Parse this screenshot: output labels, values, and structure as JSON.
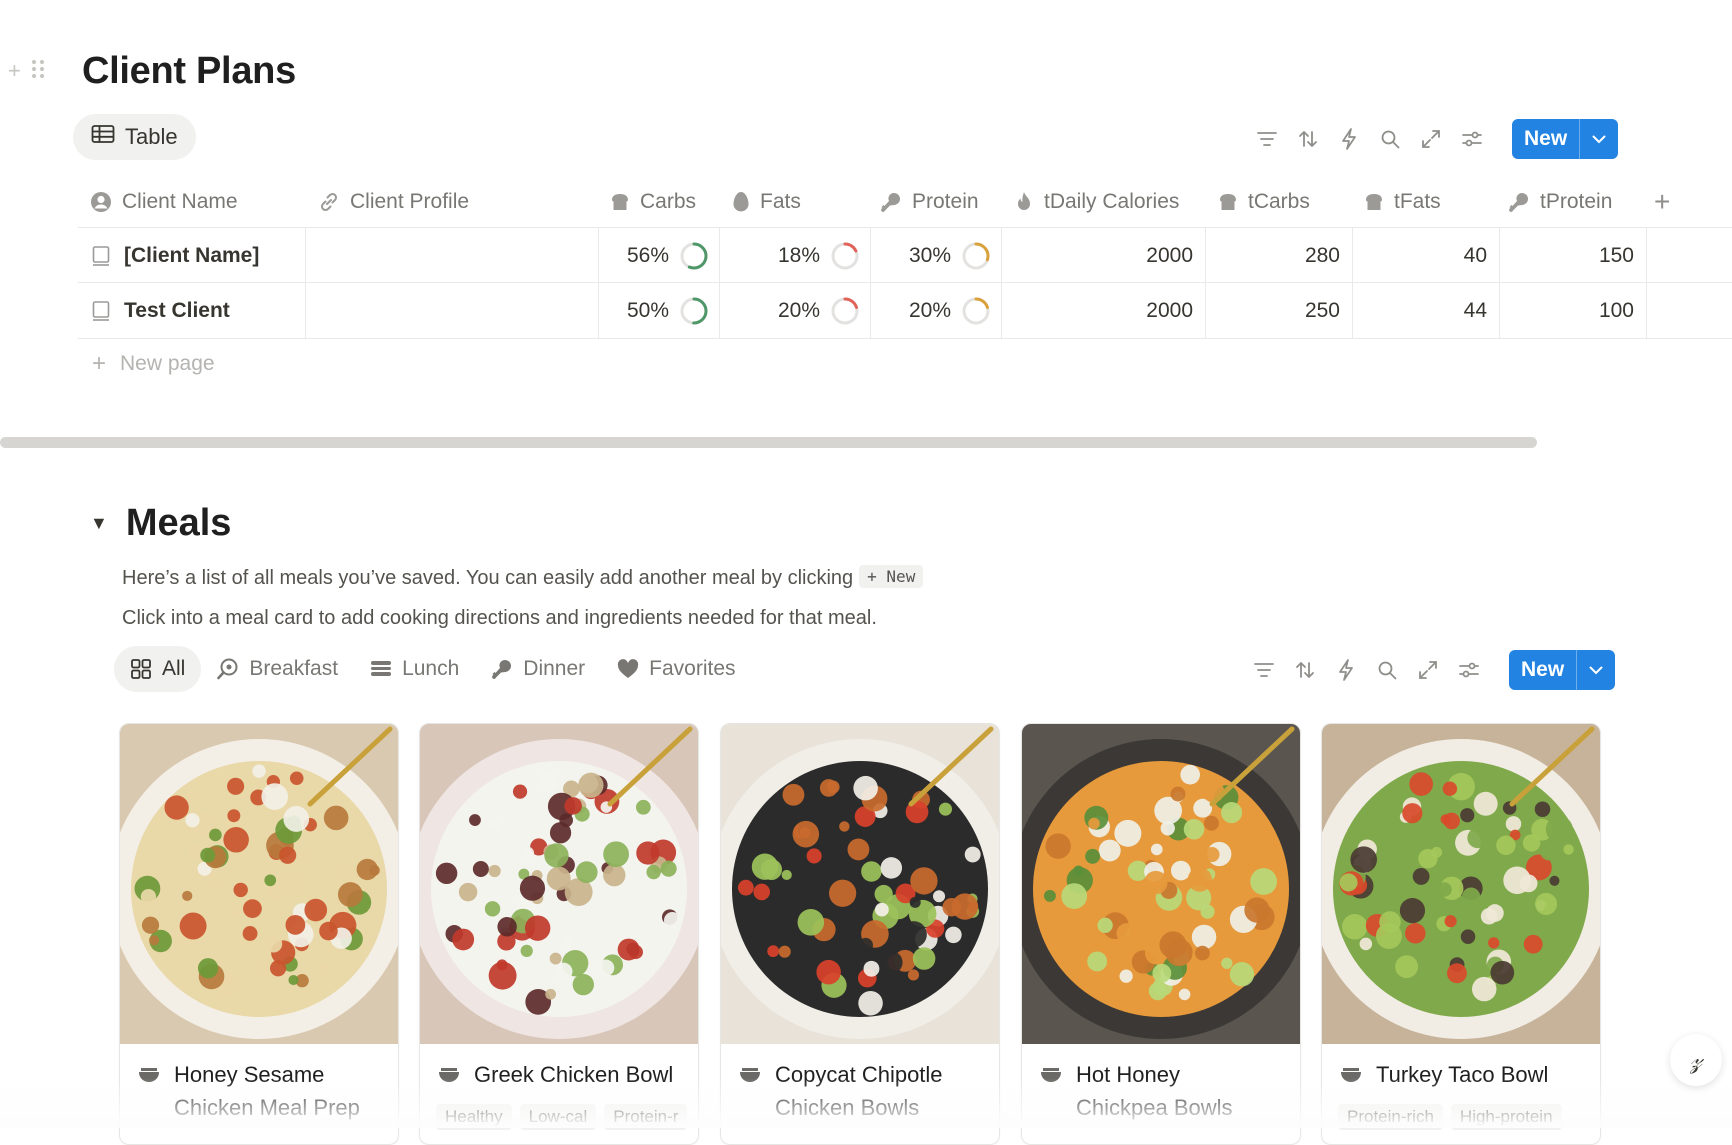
{
  "page": {
    "title": "Client Plans"
  },
  "client_view": {
    "label": "Table",
    "icon": "table-icon"
  },
  "toolbar": {
    "new_label": "New"
  },
  "table": {
    "columns": [
      {
        "label": "Client Name",
        "icon": "person-icon"
      },
      {
        "label": "Client Profile",
        "icon": "link-icon"
      },
      {
        "label": "Carbs",
        "icon": "bread-icon"
      },
      {
        "label": "Fats",
        "icon": "egg-icon"
      },
      {
        "label": "Protein",
        "icon": "drumstick-icon"
      },
      {
        "label": "tDaily Calories",
        "icon": "flame-icon"
      },
      {
        "label": "tCarbs",
        "icon": "bread-icon"
      },
      {
        "label": "tFats",
        "icon": "bread-icon"
      },
      {
        "label": "tProtein",
        "icon": "drumstick-icon"
      }
    ],
    "rows": [
      {
        "name": "[Client Name]",
        "profile": "",
        "carbs": "56%",
        "carbs_value": 0.56,
        "fats": "18%",
        "fats_value": 0.18,
        "protein": "30%",
        "protein_value": 0.3,
        "daily_calories": "2000",
        "tcarbs": "280",
        "tfats": "40",
        "tprotein": "150"
      },
      {
        "name": "Test Client",
        "profile": "",
        "carbs": "50%",
        "carbs_value": 0.5,
        "fats": "20%",
        "fats_value": 0.2,
        "protein": "20%",
        "protein_value": 0.2,
        "daily_calories": "2000",
        "tcarbs": "250",
        "tfats": "44",
        "tprotein": "100"
      }
    ],
    "new_page_label": "New page",
    "ring_colors": {
      "carbs": "#4f9768",
      "fats": "#e16259",
      "protein": "#d9a13a"
    }
  },
  "meals": {
    "title": "Meals",
    "description_1": "Here’s a list of all meals you’ve saved. You can easily add another meal by clicking",
    "inline_button": "+ New",
    "description_2": "Click into a meal card to add cooking directions and ingredients needed for that meal.",
    "tabs": [
      {
        "label": "All",
        "icon": "grid-icon",
        "active": true
      },
      {
        "label": "Breakfast",
        "icon": "frying-pan-icon",
        "active": false
      },
      {
        "label": "Lunch",
        "icon": "sandwich-icon",
        "active": false
      },
      {
        "label": "Dinner",
        "icon": "drumstick-icon",
        "active": false
      },
      {
        "label": "Favorites",
        "icon": "heart-icon",
        "active": false
      }
    ],
    "new_label": "New",
    "cards": [
      {
        "title_line1": "Honey Sesame",
        "title_line2": "Chicken Meal Prep",
        "tags": []
      },
      {
        "title_line1": "Greek Chicken Bowl",
        "title_line2": "",
        "tags": [
          "Healthy",
          "Low-cal",
          "Protein-r"
        ]
      },
      {
        "title_line1": "Copycat Chipotle",
        "title_line2": "Chicken Bowls",
        "tags": []
      },
      {
        "title_line1": "Hot Honey",
        "title_line2": "Chickpea Bowls",
        "tags": []
      },
      {
        "title_line1": "Turkey Taco Bowl",
        "title_line2": "",
        "tags": [
          "Protein-rich",
          "High-protein"
        ]
      }
    ]
  },
  "colors": {
    "accent": "#2383e2",
    "text": "#37352f",
    "muted": "#787774"
  }
}
